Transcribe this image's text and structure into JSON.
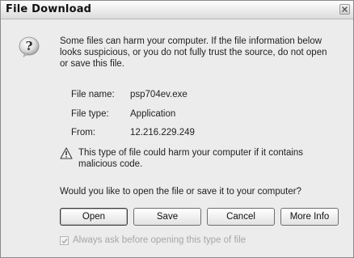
{
  "dialog": {
    "title": "File Download",
    "warning_message": "Some files can harm your computer. If the file information below looks suspicious, or you do not fully trust the source, do not open or save this file.",
    "file_info": {
      "name_label": "File name:",
      "name_value": "psp704ev.exe",
      "type_label": "File type:",
      "type_value": "Application",
      "from_label": "From:",
      "from_value": "12.216.229.249"
    },
    "harm_message": "This type of file could harm your computer if it contains malicious code.",
    "question": "Would you like to open the file or save it to your computer?",
    "buttons": {
      "open": "Open",
      "save": "Save",
      "cancel": "Cancel",
      "more_info": "More Info"
    },
    "always_ask": {
      "label": "Always ask before opening this type of file",
      "checked": true,
      "enabled": false
    }
  },
  "icons": {
    "question": "question-icon",
    "warning": "warning-icon",
    "close": "close-icon",
    "check": "checkmark-icon"
  }
}
